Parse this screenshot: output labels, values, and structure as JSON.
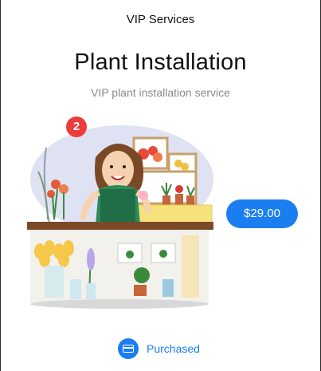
{
  "nav": {
    "title": "VIP Services"
  },
  "hero": {
    "title": "Plant Installation",
    "subtitle": "VIP plant installation service"
  },
  "illustration": {
    "icon": "florist-shop-illustration",
    "badge_count": "2"
  },
  "price": {
    "label": "$29.00",
    "color": "#1a7ef0"
  },
  "status": {
    "label": "Purchased",
    "icon": "credit-card-icon"
  },
  "colors": {
    "accent": "#1a7ef0",
    "badge": "#ee3b3b",
    "subtitle": "#8a8a8a"
  }
}
